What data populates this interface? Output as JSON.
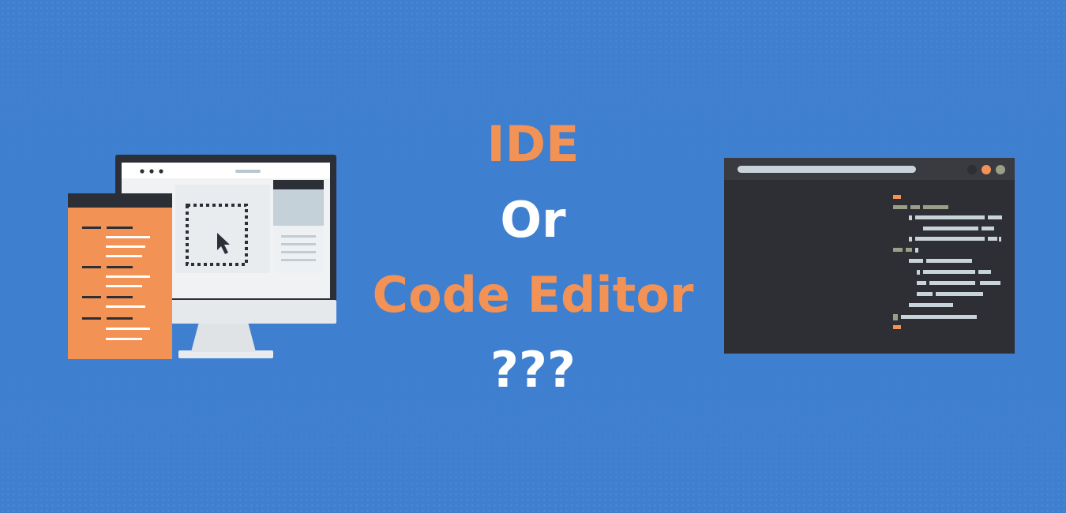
{
  "heading": {
    "line1": "IDE",
    "line2": "Or",
    "line3": "Code Editor",
    "line4": "???"
  },
  "colors": {
    "background": "#3f7fd0",
    "accent": "#f39255",
    "text_light": "#ffffff",
    "monitor_frame": "#2c2f36",
    "editor_body": "#2d2f34"
  },
  "illustrations": {
    "left": "desktop-monitor-ide-illustration",
    "right": "code-editor-window-illustration"
  }
}
